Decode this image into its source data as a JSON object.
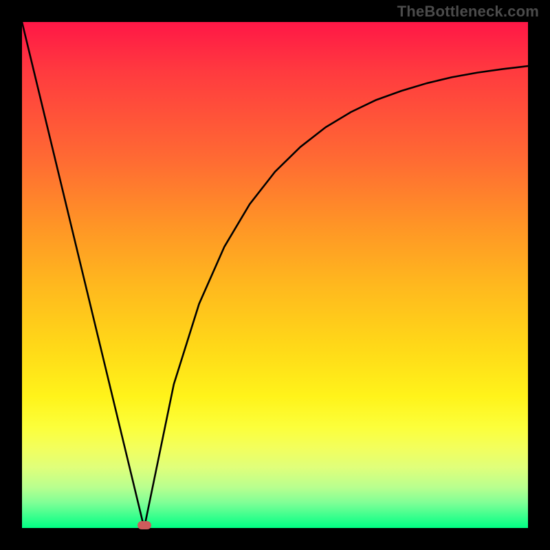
{
  "watermark": "TheBottleneck.com",
  "chart_data": {
    "type": "line",
    "title": "",
    "xlabel": "",
    "ylabel": "",
    "xlim": [
      0,
      1
    ],
    "ylim": [
      0,
      1
    ],
    "series": [
      {
        "name": "curve",
        "x": [
          0.0,
          0.05,
          0.1,
          0.15,
          0.2,
          0.2415,
          0.3,
          0.35,
          0.4,
          0.45,
          0.5,
          0.55,
          0.6,
          0.65,
          0.7,
          0.75,
          0.8,
          0.85,
          0.9,
          0.95,
          1.0
        ],
        "y": [
          1.0,
          0.793,
          0.586,
          0.379,
          0.172,
          0.0,
          0.284,
          0.443,
          0.556,
          0.64,
          0.704,
          0.753,
          0.792,
          0.822,
          0.846,
          0.864,
          0.879,
          0.891,
          0.9,
          0.907,
          0.913
        ]
      }
    ],
    "marker": {
      "x": 0.2415,
      "y": 0.0
    },
    "background_gradient": {
      "top": "#ff1746",
      "mid": "#ffd818",
      "bottom": "#00ff84"
    }
  }
}
